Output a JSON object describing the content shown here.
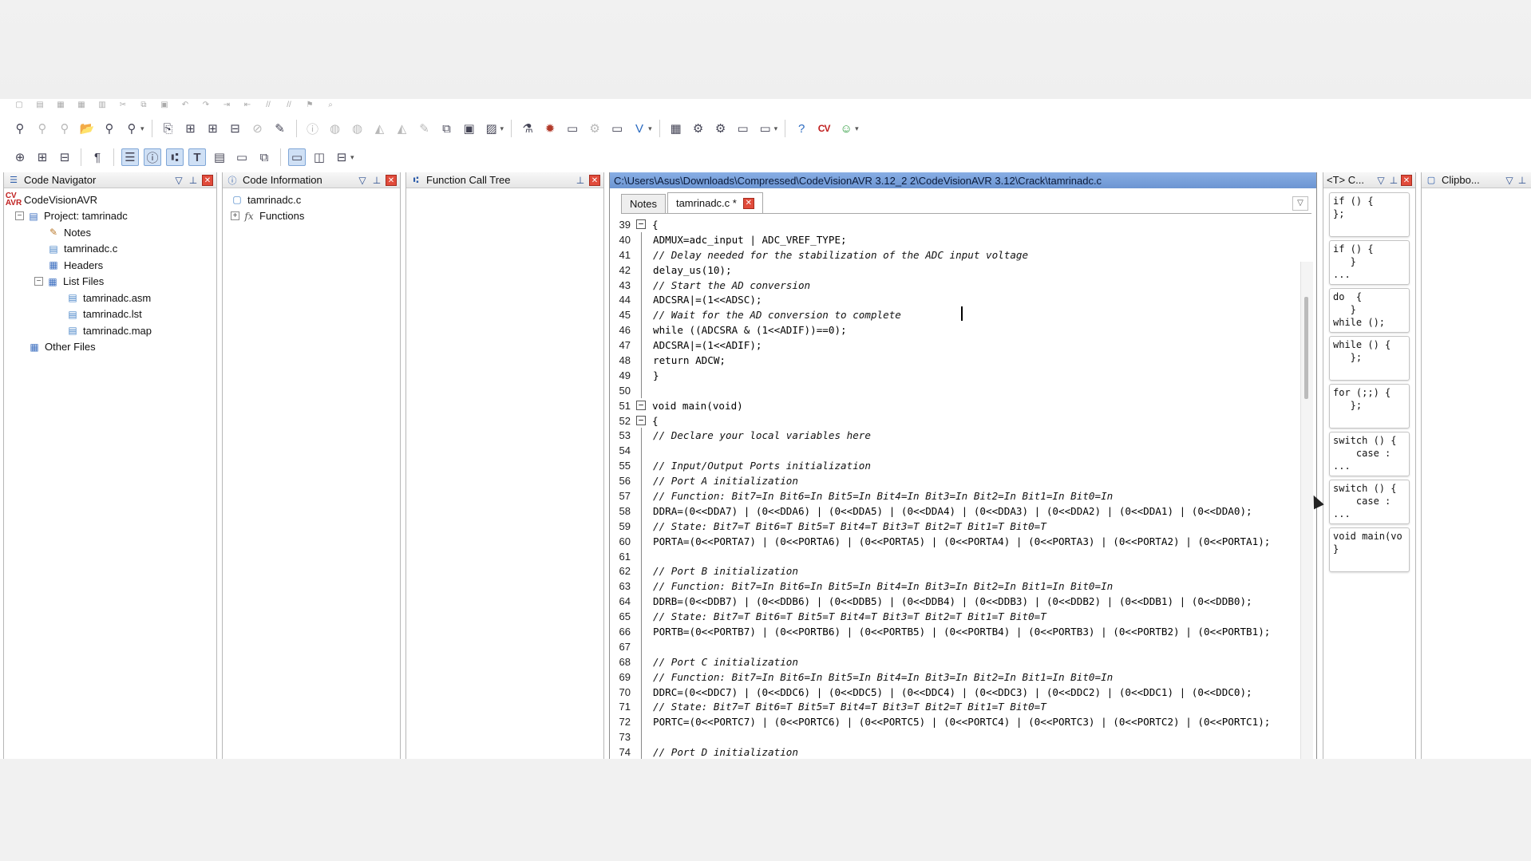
{
  "toolbar1": {
    "icons": [
      "binoculars-icon",
      "find-next-icon",
      "find-prev-icon",
      "open-folder-icon",
      "find-in-files-icon",
      "replace-icon",
      "goto-icon",
      "tree-icon",
      "tree2-icon",
      "stop-icon",
      "brush-icon",
      "info-icon",
      "chip-icon",
      "chip2-icon",
      "chip3-icon",
      "chip4-icon",
      "edit-icon",
      "copy-icon",
      "paste-icon",
      "programmer-icon",
      "flask-icon",
      "bug-icon",
      "device-icon",
      "gear-icon",
      "monitor-icon",
      "check-icon",
      "wizard-icon",
      "settings-icon",
      "tools-icon",
      "export-icon",
      "help-icon",
      "cvavr-icon",
      "about-icon"
    ],
    "logo_text": "CV\nAVR"
  },
  "code_navigator": {
    "title": "Code Navigator",
    "root": "CodeVisionAVR",
    "project": "Project: tamrinadc",
    "notes": "Notes",
    "source": "tamrinadc.c",
    "headers": "Headers",
    "list_files": "List Files",
    "list_items": [
      "tamrinadc.asm",
      "tamrinadc.lst",
      "tamrinadc.map"
    ],
    "other_files": "Other Files"
  },
  "code_information": {
    "title": "Code Information",
    "file": "tamrinadc.c",
    "functions": "Functions"
  },
  "function_call_tree": {
    "title": "Function Call Tree"
  },
  "editor": {
    "path": "C:\\Users\\Asus\\Downloads\\Compressed\\CodeVisionAVR 3.12_2 2\\CodeVisionAVR 3.12\\Crack\\tamrinadc.c",
    "tabs": [
      "Notes",
      "tamrinadc.c *"
    ],
    "lines": [
      {
        "n": "39",
        "fold": "minus",
        "t": "{",
        "c": false
      },
      {
        "n": "40",
        "fold": "",
        "t": "ADMUX=adc_input | ADC_VREF_TYPE;",
        "c": false
      },
      {
        "n": "41",
        "fold": "",
        "t": "// Delay needed for the stabilization of the ADC input voltage",
        "c": true
      },
      {
        "n": "42",
        "fold": "",
        "t": "delay_us(10);",
        "c": false
      },
      {
        "n": "43",
        "fold": "",
        "t": "// Start the AD conversion",
        "c": true
      },
      {
        "n": "44",
        "fold": "",
        "t": "ADCSRA|=(1<<ADSC);",
        "c": false
      },
      {
        "n": "45",
        "fold": "",
        "t": "// Wait for the AD conversion to complete",
        "c": true
      },
      {
        "n": "46",
        "fold": "",
        "t": "while ((ADCSRA & (1<<ADIF))==0);",
        "c": false
      },
      {
        "n": "47",
        "fold": "",
        "t": "ADCSRA|=(1<<ADIF);",
        "c": false
      },
      {
        "n": "48",
        "fold": "",
        "t": "return ADCW;",
        "c": false
      },
      {
        "n": "49",
        "fold": "",
        "t": "}",
        "c": false
      },
      {
        "n": "50",
        "fold": "",
        "t": "",
        "c": false
      },
      {
        "n": "51",
        "fold": "minus",
        "t": "void main(void)",
        "c": false
      },
      {
        "n": "52",
        "fold": "minus",
        "t": "{",
        "c": false
      },
      {
        "n": "53",
        "fold": "",
        "t": "// Declare your local variables here",
        "c": true
      },
      {
        "n": "54",
        "fold": "",
        "t": "",
        "c": false
      },
      {
        "n": "55",
        "fold": "",
        "t": "// Input/Output Ports initialization",
        "c": true
      },
      {
        "n": "56",
        "fold": "",
        "t": "// Port A initialization",
        "c": true
      },
      {
        "n": "57",
        "fold": "",
        "t": "// Function: Bit7=In Bit6=In Bit5=In Bit4=In Bit3=In Bit2=In Bit1=In Bit0=In",
        "c": true
      },
      {
        "n": "58",
        "fold": "",
        "t": "DDRA=(0<<DDA7) | (0<<DDA6) | (0<<DDA5) | (0<<DDA4) | (0<<DDA3) | (0<<DDA2) | (0<<DDA1) | (0<<DDA0);",
        "c": false
      },
      {
        "n": "59",
        "fold": "",
        "t": "// State: Bit7=T Bit6=T Bit5=T Bit4=T Bit3=T Bit2=T Bit1=T Bit0=T",
        "c": true
      },
      {
        "n": "60",
        "fold": "",
        "t": "PORTA=(0<<PORTA7) | (0<<PORTA6) | (0<<PORTA5) | (0<<PORTA4) | (0<<PORTA3) | (0<<PORTA2) | (0<<PORTA1);",
        "c": false
      },
      {
        "n": "61",
        "fold": "",
        "t": "",
        "c": false
      },
      {
        "n": "62",
        "fold": "",
        "t": "// Port B initialization",
        "c": true
      },
      {
        "n": "63",
        "fold": "",
        "t": "// Function: Bit7=In Bit6=In Bit5=In Bit4=In Bit3=In Bit2=In Bit1=In Bit0=In",
        "c": true
      },
      {
        "n": "64",
        "fold": "",
        "t": "DDRB=(0<<DDB7) | (0<<DDB6) | (0<<DDB5) | (0<<DDB4) | (0<<DDB3) | (0<<DDB2) | (0<<DDB1) | (0<<DDB0);",
        "c": false
      },
      {
        "n": "65",
        "fold": "",
        "t": "// State: Bit7=T Bit6=T Bit5=T Bit4=T Bit3=T Bit2=T Bit1=T Bit0=T",
        "c": true
      },
      {
        "n": "66",
        "fold": "",
        "t": "PORTB=(0<<PORTB7) | (0<<PORTB6) | (0<<PORTB5) | (0<<PORTB4) | (0<<PORTB3) | (0<<PORTB2) | (0<<PORTB1);",
        "c": false
      },
      {
        "n": "67",
        "fold": "",
        "t": "",
        "c": false
      },
      {
        "n": "68",
        "fold": "",
        "t": "// Port C initialization",
        "c": true
      },
      {
        "n": "69",
        "fold": "",
        "t": "// Function: Bit7=In Bit6=In Bit5=In Bit4=In Bit3=In Bit2=In Bit1=In Bit0=In",
        "c": true
      },
      {
        "n": "70",
        "fold": "",
        "t": "DDRC=(0<<DDC7) | (0<<DDC6) | (0<<DDC5) | (0<<DDC4) | (0<<DDC3) | (0<<DDC2) | (0<<DDC1) | (0<<DDC0);",
        "c": false
      },
      {
        "n": "71",
        "fold": "",
        "t": "// State: Bit7=T Bit6=T Bit5=T Bit4=T Bit3=T Bit2=T Bit1=T Bit0=T",
        "c": true
      },
      {
        "n": "72",
        "fold": "",
        "t": "PORTC=(0<<PORTC7) | (0<<PORTC6) | (0<<PORTC5) | (0<<PORTC4) | (0<<PORTC3) | (0<<PORTC2) | (0<<PORTC1);",
        "c": false
      },
      {
        "n": "73",
        "fold": "",
        "t": "",
        "c": false
      },
      {
        "n": "74",
        "fold": "",
        "t": "// Port D initialization",
        "c": true
      }
    ]
  },
  "templates": {
    "title": "<T> C...",
    "snippets": [
      "if () {\n};",
      "if () {\n   }\n...",
      "do  {\n   }\nwhile ();",
      "while () {\n   };",
      "for (;;) {\n   };",
      "switch () {\n    case :\n...",
      "switch () {\n    case :\n...",
      "void main(vo\n}"
    ]
  },
  "clipboard": {
    "title": "Clipbo..."
  }
}
